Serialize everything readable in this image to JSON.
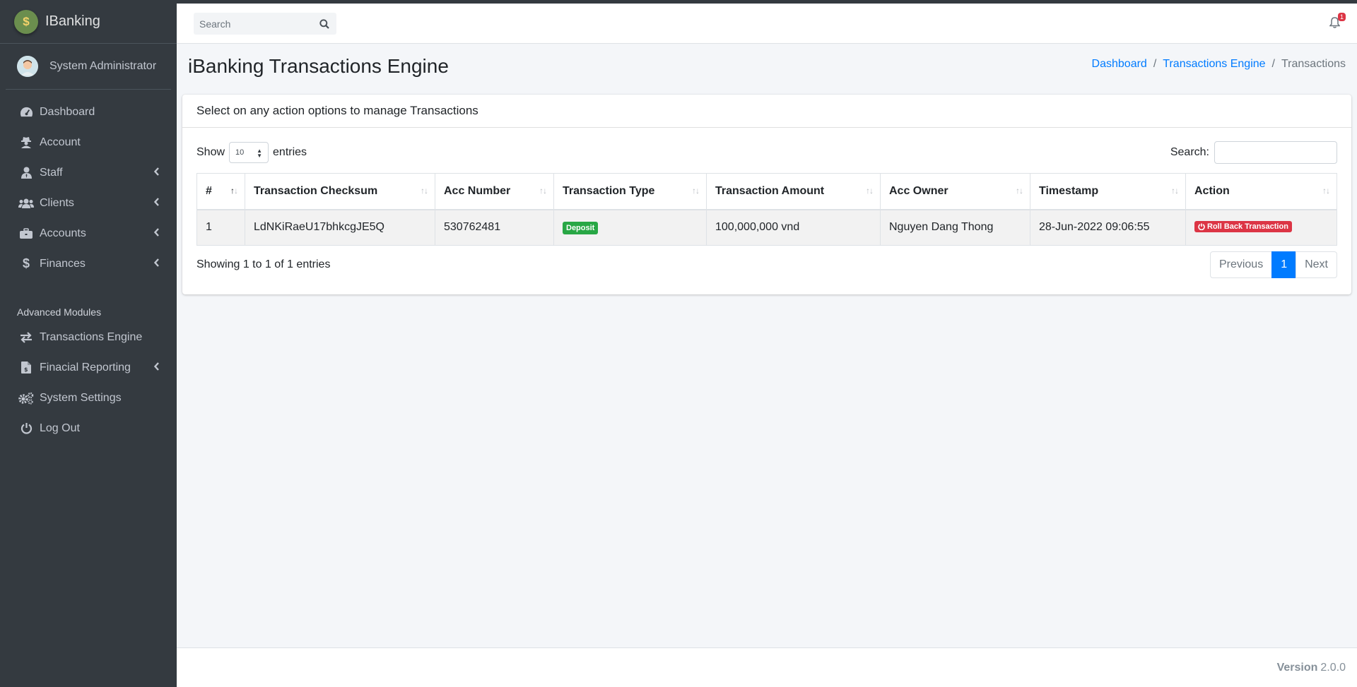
{
  "app": {
    "brand": "IBanking",
    "user": "System Administrator"
  },
  "sidebar": {
    "items": [
      {
        "label": "Dashboard",
        "icon": "tachometer-icon",
        "has_submenu": false
      },
      {
        "label": "Account",
        "icon": "user-secret-icon",
        "has_submenu": false
      },
      {
        "label": "Staff",
        "icon": "user-tie-icon",
        "has_submenu": true
      },
      {
        "label": "Clients",
        "icon": "users-icon",
        "has_submenu": true
      },
      {
        "label": "Accounts",
        "icon": "briefcase-icon",
        "has_submenu": true
      },
      {
        "label": "Finances",
        "icon": "dollar-icon",
        "has_submenu": true
      }
    ],
    "section_header": "Advanced Modules",
    "advanced": [
      {
        "label": "Transactions Engine",
        "icon": "exchange-icon",
        "has_submenu": false
      },
      {
        "label": "Finacial Reporting",
        "icon": "invoice-icon",
        "has_submenu": true
      },
      {
        "label": "System Settings",
        "icon": "cogs-icon",
        "has_submenu": false
      },
      {
        "label": "Log Out",
        "icon": "power-off-icon",
        "has_submenu": false
      }
    ]
  },
  "topnav": {
    "search_placeholder": "Search",
    "notification_count": "1"
  },
  "header": {
    "title": "iBanking Transactions Engine",
    "breadcrumb": [
      "Dashboard",
      "Transactions Engine",
      "Transactions"
    ]
  },
  "card": {
    "title": "Select on any action options to manage Transactions",
    "show_label": "Show",
    "entries_label": "entries",
    "page_length": "10",
    "search_label": "Search:",
    "columns": [
      "#",
      "Transaction Checksum",
      "Acc Number",
      "Transaction Type",
      "Transaction Amount",
      "Acc Owner",
      "Timestamp",
      "Action"
    ],
    "rows": [
      {
        "num": "1",
        "checksum": "LdNKiRaeU17bhkcgJE5Q",
        "acc_number": "530762481",
        "type": "Deposit",
        "amount": "100,000,000 vnd",
        "owner": "Nguyen Dang Thong",
        "timestamp": "28-Jun-2022 09:06:55",
        "action": "Roll Back Transaction"
      }
    ],
    "info": "Showing 1 to 1 of 1 entries",
    "pagination": {
      "previous": "Previous",
      "current": "1",
      "next": "Next"
    }
  },
  "footer": {
    "version_label": "Version",
    "version": "2.0.0"
  },
  "colors": {
    "sidebar": "#343a40",
    "primary": "#007bff",
    "success": "#28a745",
    "danger": "#dc3545"
  }
}
